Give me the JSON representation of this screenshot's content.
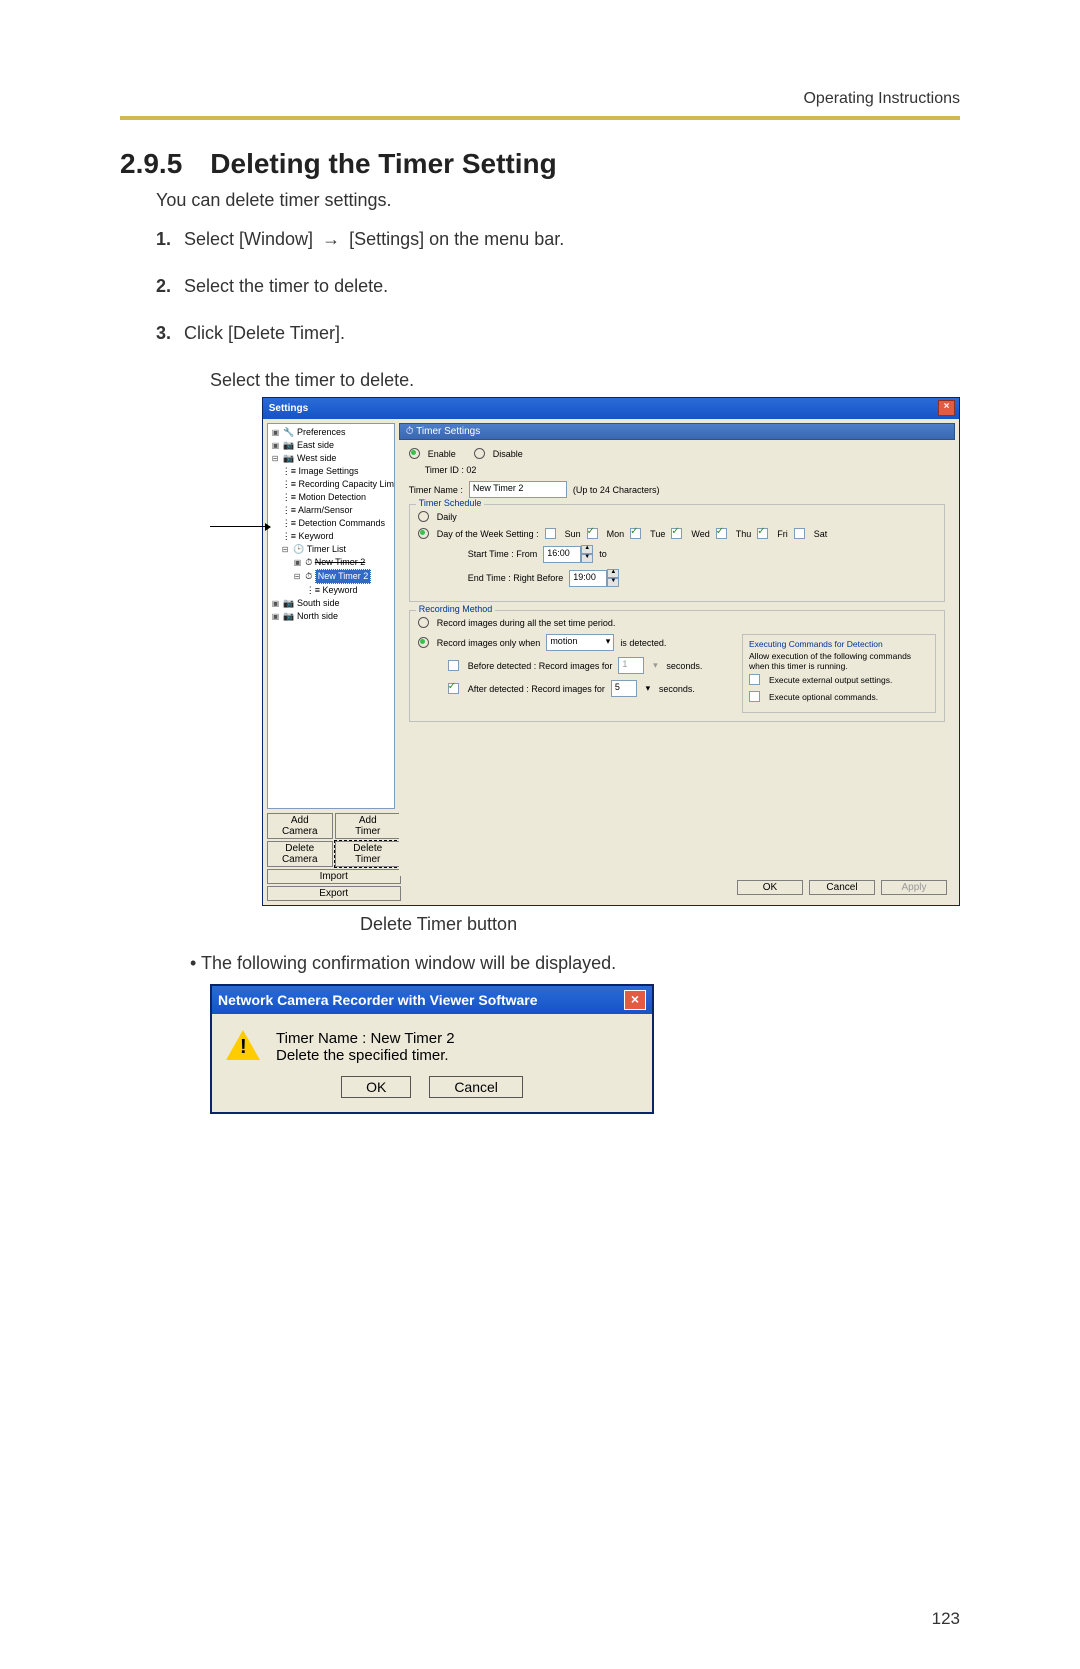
{
  "header": {
    "running": "Operating Instructions"
  },
  "heading": {
    "number": "2.9.5",
    "title": "Deleting the Timer Setting"
  },
  "intro": "You can delete timer settings.",
  "steps": [
    {
      "n": "1.",
      "before": "Select [Window]",
      "after": "[Settings] on the menu bar."
    },
    {
      "n": "2.",
      "text": "Select the timer to delete."
    },
    {
      "n": "3.",
      "text": "Click [Delete Timer]."
    }
  ],
  "caption1": "Select the timer to delete.",
  "caption2": "Delete Timer button",
  "bullet": "• The following confirmation window will be displayed.",
  "page_num": "123",
  "settings_window": {
    "title": "Settings",
    "tree": {
      "preferences": "Preferences",
      "east": "East side",
      "west": "West side",
      "image_settings": "Image Settings",
      "rec_cap": "Recording Capacity Limit",
      "motion": "Motion Detection",
      "alarm": "Alarm/Sensor",
      "det_cmd": "Detection Commands",
      "keyword": "Keyword",
      "timer_list": "Timer List",
      "new_timer_a": "New Timer 2",
      "new_timer_sel": "New Timer 2",
      "keyword2": "Keyword",
      "south": "South side",
      "north": "North side"
    },
    "panel_title": "Timer Settings",
    "enable": "Enable",
    "disable": "Disable",
    "timer_id_label": "Timer ID : 02",
    "name_label": "Timer Name :",
    "name_value": "New Timer 2",
    "name_hint": "(Up to 24 Characters)",
    "sched_legend": "Timer Schedule",
    "daily": "Daily",
    "dow_label": "Day of the Week Setting :",
    "days": {
      "sun": "Sun",
      "mon": "Mon",
      "tue": "Tue",
      "wed": "Wed",
      "thu": "Thu",
      "fri": "Fri",
      "sat": "Sat"
    },
    "start_label": "Start Time :  From",
    "start_val": "16:00",
    "to": "to",
    "end_label": "End Time :  Right Before",
    "end_val": "19:00",
    "rec_legend": "Recording Method",
    "rec_all": "Record images during all the set time period.",
    "rec_only": "Record images only when",
    "motion_opt": "motion",
    "is_detected": "is detected.",
    "before_label": "Before detected :  Record images for",
    "before_val": "1",
    "after_label": "After   detected :  Record images for",
    "after_val": "5",
    "seconds": "seconds.",
    "exec_title": "Executing Commands for Detection",
    "exec_desc": "Allow execution of the following commands when this timer is running.",
    "exec_ext": "Execute external output settings.",
    "exec_opt": "Execute optional commands.",
    "btns": {
      "ok": "OK",
      "cancel": "Cancel",
      "apply": "Apply"
    },
    "left_btns": {
      "add_cam": "Add Camera",
      "add_timer": "Add Timer",
      "del_cam": "Delete Camera",
      "del_timer": "Delete Timer",
      "import": "Import",
      "export": "Export"
    }
  },
  "confirm": {
    "title": "Network Camera Recorder with Viewer Software",
    "line1": "Timer Name : New Timer 2",
    "line2": "Delete the specified timer.",
    "ok": "OK",
    "cancel": "Cancel"
  }
}
